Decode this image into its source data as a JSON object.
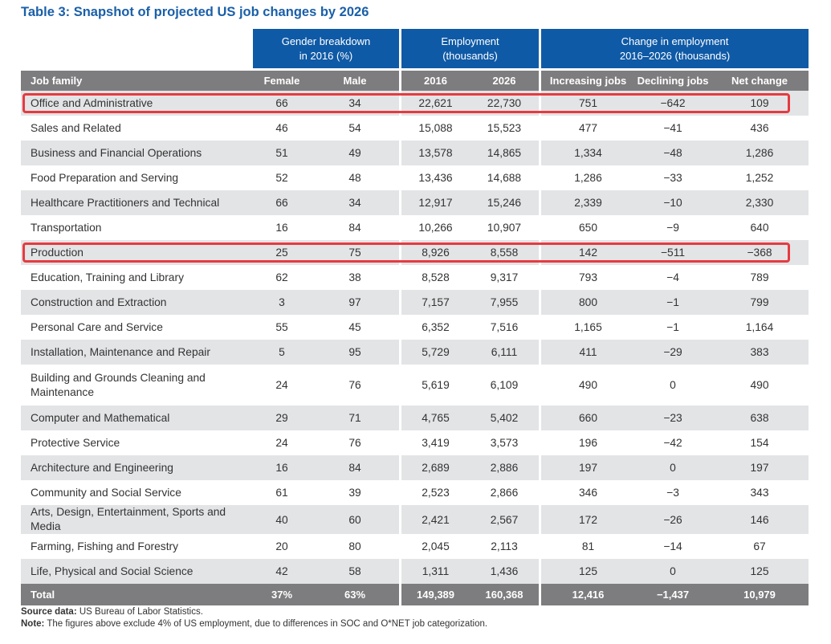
{
  "title": "Table 3: Snapshot of projected US job changes by 2026",
  "group_headers": {
    "gender": "Gender breakdown\nin 2016 (%)",
    "employment": "Employment\n(thousands)",
    "change": "Change in employment\n2016–2026 (thousands)"
  },
  "columns": {
    "job": "Job family",
    "female": "Female",
    "male": "Male",
    "y2016": "2016",
    "y2026": "2026",
    "inc": "Increasing jobs",
    "dec": "Declining jobs",
    "net": "Net change"
  },
  "rows": [
    {
      "job": "Office and Administrative",
      "female": "66",
      "male": "34",
      "y2016": "22,621",
      "y2026": "22,730",
      "inc": "751",
      "dec": "−642",
      "net": "109"
    },
    {
      "job": "Sales and Related",
      "female": "46",
      "male": "54",
      "y2016": "15,088",
      "y2026": "15,523",
      "inc": "477",
      "dec": "−41",
      "net": "436"
    },
    {
      "job": "Business and Financial Operations",
      "female": "51",
      "male": "49",
      "y2016": "13,578",
      "y2026": "14,865",
      "inc": "1,334",
      "dec": "−48",
      "net": "1,286"
    },
    {
      "job": "Food Preparation and Serving",
      "female": "52",
      "male": "48",
      "y2016": "13,436",
      "y2026": "14,688",
      "inc": "1,286",
      "dec": "−33",
      "net": "1,252"
    },
    {
      "job": "Healthcare Practitioners and Technical",
      "female": "66",
      "male": "34",
      "y2016": "12,917",
      "y2026": "15,246",
      "inc": "2,339",
      "dec": "−10",
      "net": "2,330"
    },
    {
      "job": "Transportation",
      "female": "16",
      "male": "84",
      "y2016": "10,266",
      "y2026": "10,907",
      "inc": "650",
      "dec": "−9",
      "net": "640"
    },
    {
      "job": "Production",
      "female": "25",
      "male": "75",
      "y2016": "8,926",
      "y2026": "8,558",
      "inc": "142",
      "dec": "−511",
      "net": "−368"
    },
    {
      "job": "Education, Training and Library",
      "female": "62",
      "male": "38",
      "y2016": "8,528",
      "y2026": "9,317",
      "inc": "793",
      "dec": "−4",
      "net": "789"
    },
    {
      "job": "Construction and Extraction",
      "female": "3",
      "male": "97",
      "y2016": "7,157",
      "y2026": "7,955",
      "inc": "800",
      "dec": "−1",
      "net": "799"
    },
    {
      "job": "Personal Care and Service",
      "female": "55",
      "male": "45",
      "y2016": "6,352",
      "y2026": "7,516",
      "inc": "1,165",
      "dec": "−1",
      "net": "1,164"
    },
    {
      "job": "Installation, Maintenance and Repair",
      "female": "5",
      "male": "95",
      "y2016": "5,729",
      "y2026": "6,111",
      "inc": "411",
      "dec": "−29",
      "net": "383"
    },
    {
      "job": "Building and Grounds Cleaning and\nMaintenance",
      "female": "24",
      "male": "76",
      "y2016": "5,619",
      "y2026": "6,109",
      "inc": "490",
      "dec": "0",
      "net": "490"
    },
    {
      "job": "Computer and Mathematical",
      "female": "29",
      "male": "71",
      "y2016": "4,765",
      "y2026": "5,402",
      "inc": "660",
      "dec": "−23",
      "net": "638"
    },
    {
      "job": "Protective Service",
      "female": "24",
      "male": "76",
      "y2016": "3,419",
      "y2026": "3,573",
      "inc": "196",
      "dec": "−42",
      "net": "154"
    },
    {
      "job": "Architecture and Engineering",
      "female": "16",
      "male": "84",
      "y2016": "2,689",
      "y2026": "2,886",
      "inc": "197",
      "dec": "0",
      "net": "197"
    },
    {
      "job": "Community and Social Service",
      "female": "61",
      "male": "39",
      "y2016": "2,523",
      "y2026": "2,866",
      "inc": "346",
      "dec": "−3",
      "net": "343"
    },
    {
      "job": "Arts, Design, Entertainment, Sports and Media",
      "female": "40",
      "male": "60",
      "y2016": "2,421",
      "y2026": "2,567",
      "inc": "172",
      "dec": "−26",
      "net": "146"
    },
    {
      "job": "Farming, Fishing and Forestry",
      "female": "20",
      "male": "80",
      "y2016": "2,045",
      "y2026": "2,113",
      "inc": "81",
      "dec": "−14",
      "net": "67"
    },
    {
      "job": "Life, Physical and Social Science",
      "female": "42",
      "male": "58",
      "y2016": "1,311",
      "y2026": "1,436",
      "inc": "125",
      "dec": "0",
      "net": "125"
    }
  ],
  "total": {
    "job": "Total",
    "female": "37%",
    "male": "63%",
    "y2016": "149,389",
    "y2026": "160,368",
    "inc": "12,416",
    "dec": "−1,437",
    "net": "10,979"
  },
  "footer": {
    "source_label": "Source data:",
    "source_text": " US Bureau of Labor Statistics.",
    "note_label": "Note:",
    "note_text": " The figures above exclude 4% of US employment, due to differences in SOC and O*NET job categorization."
  },
  "colors": {
    "title": "#1a5fa8",
    "group_header": "#0f5aa6",
    "column_header": "#7d7d7f",
    "row_shade": "#e3e4e6",
    "highlight": "#e53b40"
  },
  "highlighted_rows": [
    "Office and Administrative",
    "Production"
  ]
}
